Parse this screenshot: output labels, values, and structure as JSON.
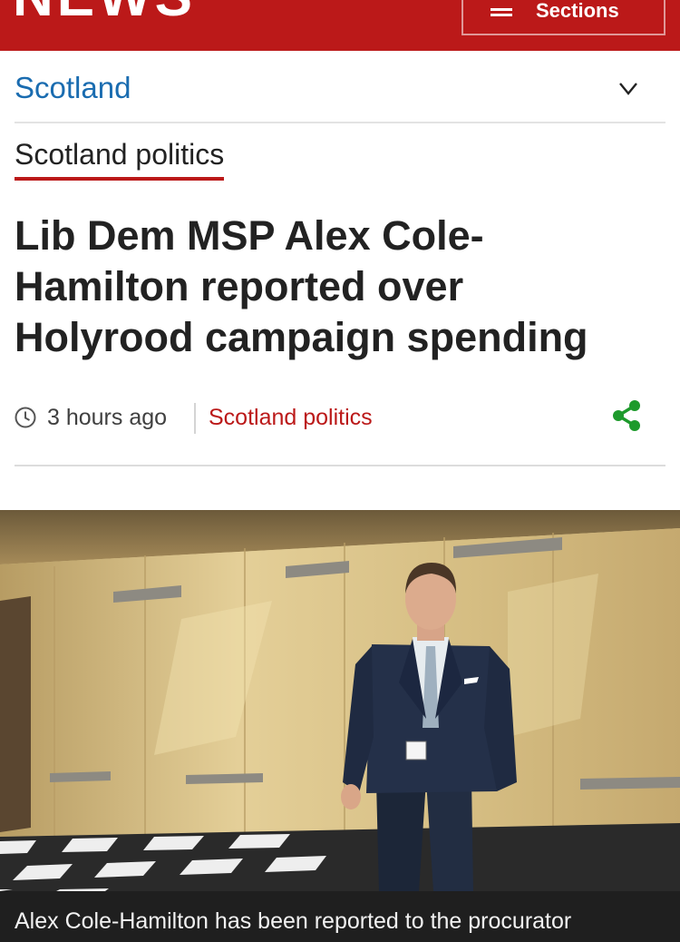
{
  "header": {
    "brand": "NEWS",
    "sections_label": "Sections",
    "brand_color": "#bb1919"
  },
  "section_nav": {
    "current": "Scotland",
    "chevron_icon": "chevron-down-icon"
  },
  "article": {
    "topic_tag": "Scotland politics",
    "headline": "Lib Dem MSP Alex Cole-Hamilton reported over Holyrood campaign spending",
    "time": "3 hours ago",
    "topic_link": "Scotland politics",
    "share_icon": "share-icon",
    "clock_icon": "clock-icon",
    "image_caption": "Alex Cole-Hamilton has been reported to the procurator"
  },
  "colors": {
    "link_blue": "#1a6cb0",
    "share_green": "#1e9a2c"
  }
}
